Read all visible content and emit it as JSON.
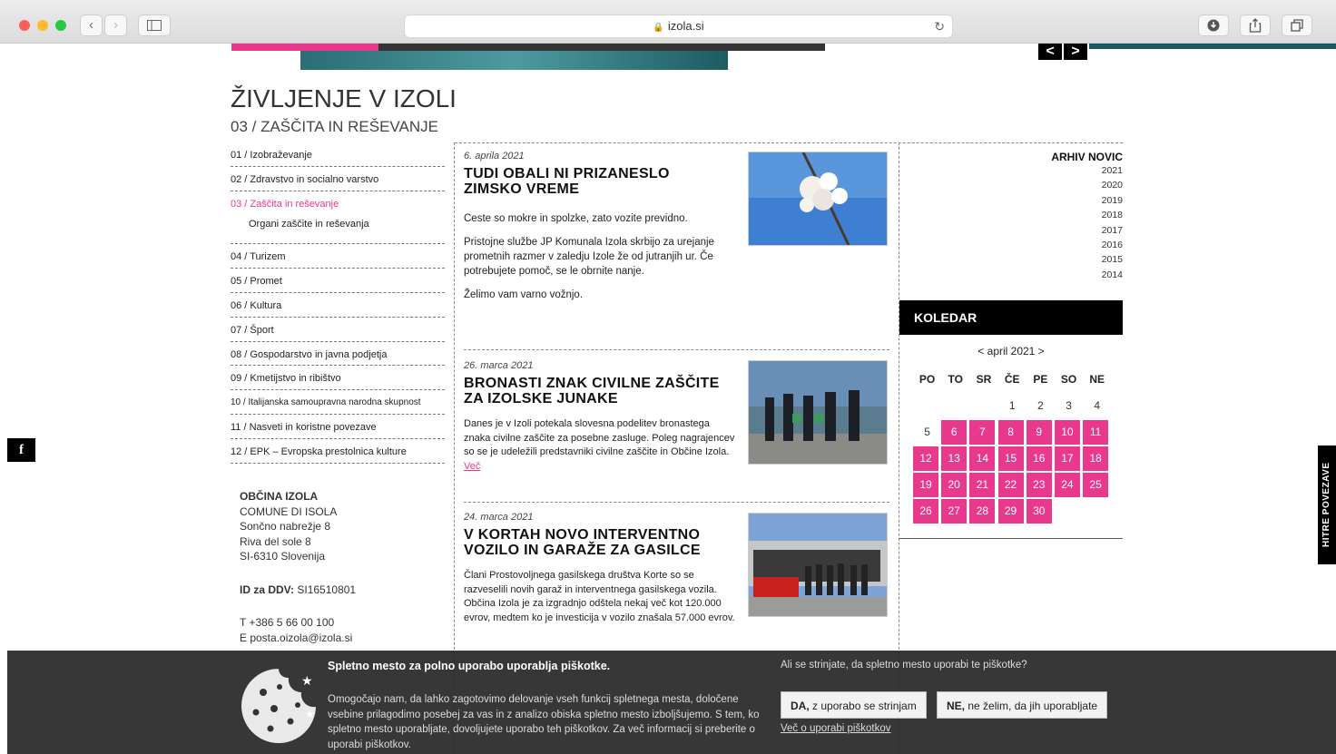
{
  "browser": {
    "url": "izola.si",
    "back": "‹",
    "forward": "›"
  },
  "site": {
    "arrow_prev": "<",
    "arrow_next": ">",
    "title": "ŽIVLJENJE V IZOLI",
    "subtitle": "03 / ZAŠČITA IN REŠEVANJE"
  },
  "menu": {
    "items": [
      "01 / Izobraževanje",
      "02 / Zdravstvo in socialno varstvo",
      "03 / Zaščita in reševanje",
      "Organi zaščite in reševanja",
      "04 / Turizem",
      "05 / Promet",
      "06 / Kultura",
      "07 / Šport",
      "08 / Gospodarstvo in javna podjetja",
      "09 / Kmetijstvo in ribištvo",
      "10 / Italijanska samoupravna narodna skupnost",
      "11 / Nasveti in koristne povezave",
      "12 / EPK – Evropska prestolnica kulture"
    ]
  },
  "address": {
    "name": "OBČINA IZOLA",
    "name_it": "COMUNE DI ISOLA",
    "street": "Sončno nabrežje 8",
    "street_it": "Riva del sole 8",
    "city": "SI-6310 Slovenija",
    "vat_label": "ID za DDV:",
    "vat": "SI16510801",
    "phone": "T +386 5 66 00 100",
    "email": "E posta.oizola@izola.si"
  },
  "news": [
    {
      "date": "6. aprila 2021",
      "title": "TUDI OBALI NI PRIZANESLO ZIMSKO VREME",
      "p1": "Ceste so mokre in spolzke, zato vozite previdno.",
      "p2": "Pristojne službe JP Komunala Izola skrbijo za urejanje prometnih razmer v zaledju Izole že od jutranjih ur. Če potrebujete pomoč, se le obrnite nanje.",
      "p3": "Želimo vam varno vožnjo."
    },
    {
      "date": "26. marca 2021",
      "title": "BRONASTI ZNAK CIVILNE ZAŠČITE ZA IZOLSKE JUNAKE",
      "p1": "Danes je v Izoli potekala slovesna podelitev bronastega znaka civilne zaščite za posebne zasluge. Poleg nagrajencev so se je udeležili predstavniki civilne zaščite in Občine Izola.",
      "more": "Več"
    },
    {
      "date": "24. marca 2021",
      "title": "V KORTAH NOVO INTERVENTNO VOZILO IN GARAŽE ZA GASILCE",
      "p1": "Člani Prostovoljnega gasilskega društva Korte so se razveselili novih garaž in interventnega gasilskega vozila. Občina Izola je za izgradnjo odštela nekaj več kot 120.000 evrov, medtem ko je investicija v vozilo znašala 57.000 evrov."
    }
  ],
  "archive": {
    "title": "ARHIV NOVIC",
    "years": [
      "2021",
      "2020",
      "2019",
      "2018",
      "2017",
      "2016",
      "2015",
      "2014"
    ]
  },
  "calendar": {
    "title": "KOLEDAR",
    "month": "< april 2021 >",
    "weekdays": [
      "PO",
      "TO",
      "SR",
      "ČE",
      "PE",
      "SO",
      "NE"
    ],
    "weeks": [
      [
        "",
        "",
        "",
        "1",
        "2",
        "3",
        "4"
      ],
      [
        "5",
        "6",
        "7",
        "8",
        "9",
        "10",
        "11"
      ],
      [
        "12",
        "13",
        "14",
        "15",
        "16",
        "17",
        "18"
      ],
      [
        "19",
        "20",
        "21",
        "22",
        "23",
        "24",
        "25"
      ],
      [
        "26",
        "27",
        "28",
        "29",
        "30",
        "",
        ""
      ]
    ],
    "highlight_color": "#e8398d"
  },
  "side": {
    "facebook": "f",
    "quick_links": "HITRE POVEZAVE"
  },
  "cookie": {
    "title": "Spletno mesto za polno uporabo uporablja piškotke.",
    "text": "Omogočajo nam, da lahko zagotovimo delovanje vseh funkcij spletnega mesta, določene vsebine prilagodimo posebej za vas in z analizo obiska spletno mesto izboljšujemo. S tem, ko spletno mesto uporabljate, dovoljujete uporabo teh piškotkov. Za več informacij si preberite o uporabi piškotkov.",
    "question": "Ali se strinjate, da spletno mesto uporabi te piškotke?",
    "yes_bold": "DA,",
    "yes_rest": " z uporabo se strinjam",
    "no_bold": "NE,",
    "no_rest": " ne želim, da jih uporabljate",
    "link": "Več o uporabi piškotkov"
  },
  "colors": {
    "accent": "#e8398d",
    "dark": "#000000"
  }
}
